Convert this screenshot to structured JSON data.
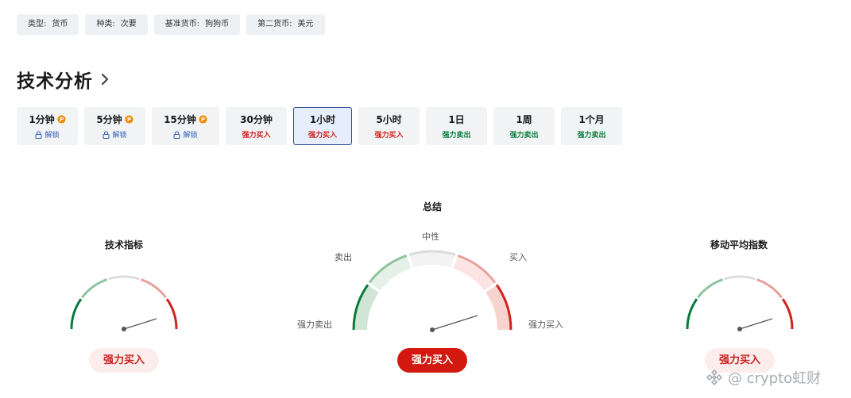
{
  "tags": [
    {
      "key": "类型:",
      "value": "货币"
    },
    {
      "key": "种类:",
      "value": "次要"
    },
    {
      "key": "基准货币:",
      "value": "狗狗币"
    },
    {
      "key": "第二货币:",
      "value": "美元"
    }
  ],
  "section": {
    "title": "技术分析"
  },
  "timeframes": [
    {
      "label": "1分钟",
      "pro": true,
      "status": "解锁"
    },
    {
      "label": "5分钟",
      "pro": true,
      "status": "解锁"
    },
    {
      "label": "15分钟",
      "pro": true,
      "status": "解锁"
    },
    {
      "label": "30分钟",
      "pro": false,
      "signal": "强力买入"
    },
    {
      "label": "1小时",
      "pro": false,
      "signal": "强力买入",
      "active": true
    },
    {
      "label": "5小时",
      "pro": false,
      "signal": "强力买入"
    },
    {
      "label": "1日",
      "pro": false,
      "signal": "强力卖出"
    },
    {
      "label": "1周",
      "pro": false,
      "signal": "强力卖出"
    },
    {
      "label": "1个月",
      "pro": false,
      "signal": "强力卖出"
    }
  ],
  "gauges": {
    "indicators": {
      "title": "技术指标",
      "result": "强力买入"
    },
    "summary": {
      "title": "总结",
      "result": "强力买入",
      "labels": {
        "neutral": "中性",
        "sell": "卖出",
        "buy": "买入",
        "strong_sell": "强力卖出",
        "strong_buy": "强力买入"
      }
    },
    "moving_averages": {
      "title": "移动平均指数",
      "result": "强力买入"
    }
  },
  "colors": {
    "strong_buy": "#d0231b",
    "buy": "#e8a19c",
    "neutral": "#dcdcdc",
    "sell": "#8fc3a0",
    "strong_sell": "#0a7a3a"
  },
  "watermark": {
    "text": "@ crypto虹财"
  }
}
